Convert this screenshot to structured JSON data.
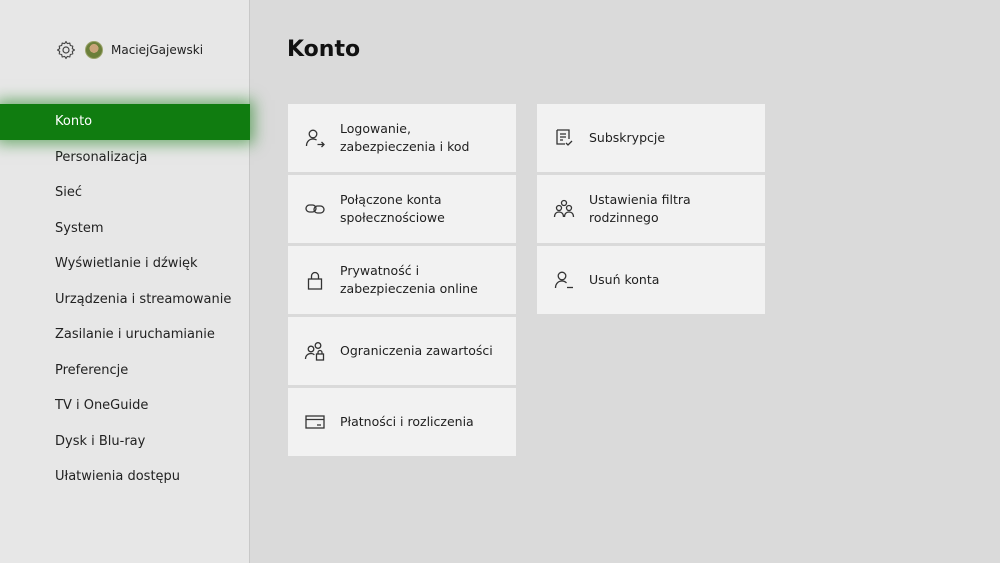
{
  "user": {
    "name": "MaciejGajewski"
  },
  "icons": {
    "settings": "gear-icon",
    "avatar": "avatar"
  },
  "nav": {
    "items": [
      {
        "label": "Konto",
        "active": true
      },
      {
        "label": "Personalizacja"
      },
      {
        "label": "Sieć"
      },
      {
        "label": "System"
      },
      {
        "label": "Wyświetlanie i dźwięk"
      },
      {
        "label": "Urządzenia i streamowanie"
      },
      {
        "label": "Zasilanie i uruchamianie"
      },
      {
        "label": "Preferencje"
      },
      {
        "label": "TV i OneGuide"
      },
      {
        "label": "Dysk i Blu-ray"
      },
      {
        "label": "Ułatwienia dostępu"
      }
    ]
  },
  "main": {
    "title": "Konto",
    "tiles": [
      {
        "label": "Logowanie,\nzabezpieczenia i kod",
        "icon": "person-arrow-icon"
      },
      {
        "label": "Połączone konta\nspołecznościowe",
        "icon": "link-icon"
      },
      {
        "label": "Prywatność i\nzabezpieczenia online",
        "icon": "lock-icon"
      },
      {
        "label": "Ograniczenia zawartości",
        "icon": "people-lock-icon"
      },
      {
        "label": "Płatności i rozliczenia",
        "icon": "credit-card-icon"
      },
      {
        "label": "Subskrypcje",
        "icon": "receipt-icon"
      },
      {
        "label": "Ustawienia filtra\nrodzinnego",
        "icon": "family-icon"
      },
      {
        "label": "Usuń konta",
        "icon": "person-remove-icon"
      }
    ]
  },
  "colors": {
    "accent": "#107c10",
    "sidebar": "#e7e7e7",
    "background": "#dadada",
    "tile": "#f2f2f2"
  }
}
